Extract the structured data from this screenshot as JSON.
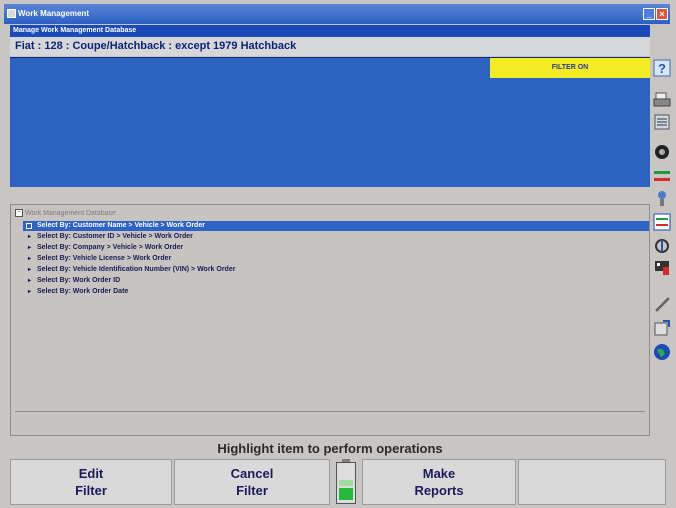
{
  "window": {
    "title": "Work Management"
  },
  "header": {
    "subtitle": "Manage Work Management Database",
    "vehicle": "Fiat : 128 : Coupe/Hatchback : except 1979 Hatchback",
    "filter_status": "FILTER ON"
  },
  "tree": {
    "root_label": "Work Management Database",
    "items": [
      {
        "label": "Select By: Customer Name > Vehicle > Work Order",
        "selected": true
      },
      {
        "label": "Select By: Customer ID > Vehicle > Work Order"
      },
      {
        "label": "Select By: Company > Vehicle > Work Order"
      },
      {
        "label": "Select By: Vehicle License > Work Order"
      },
      {
        "label": "Select By: Vehicle Identification Number (VIN) > Work Order"
      },
      {
        "label": "Select By: Work Order ID"
      },
      {
        "label": "Select By: Work Order Date"
      }
    ]
  },
  "status_text": "Highlight item to perform operations",
  "buttons": {
    "edit_filter": "Edit\nFilter",
    "cancel_filter": "Cancel\nFilter",
    "make_reports": "Make\nReports"
  },
  "toolbar_icons": [
    "help-icon",
    "printer-icon",
    "vehicle-spec-icon",
    "wheel-icon",
    "alignment-icon",
    "sensor-icon",
    "caster-icon",
    "adjust-icon",
    "flag-icon",
    "tools-icon",
    "export-icon",
    "globe-icon"
  ],
  "colors": {
    "blue_panel": "#2d63c0",
    "filter_yellow": "#f4ec22",
    "selection": "#2f62c5"
  }
}
